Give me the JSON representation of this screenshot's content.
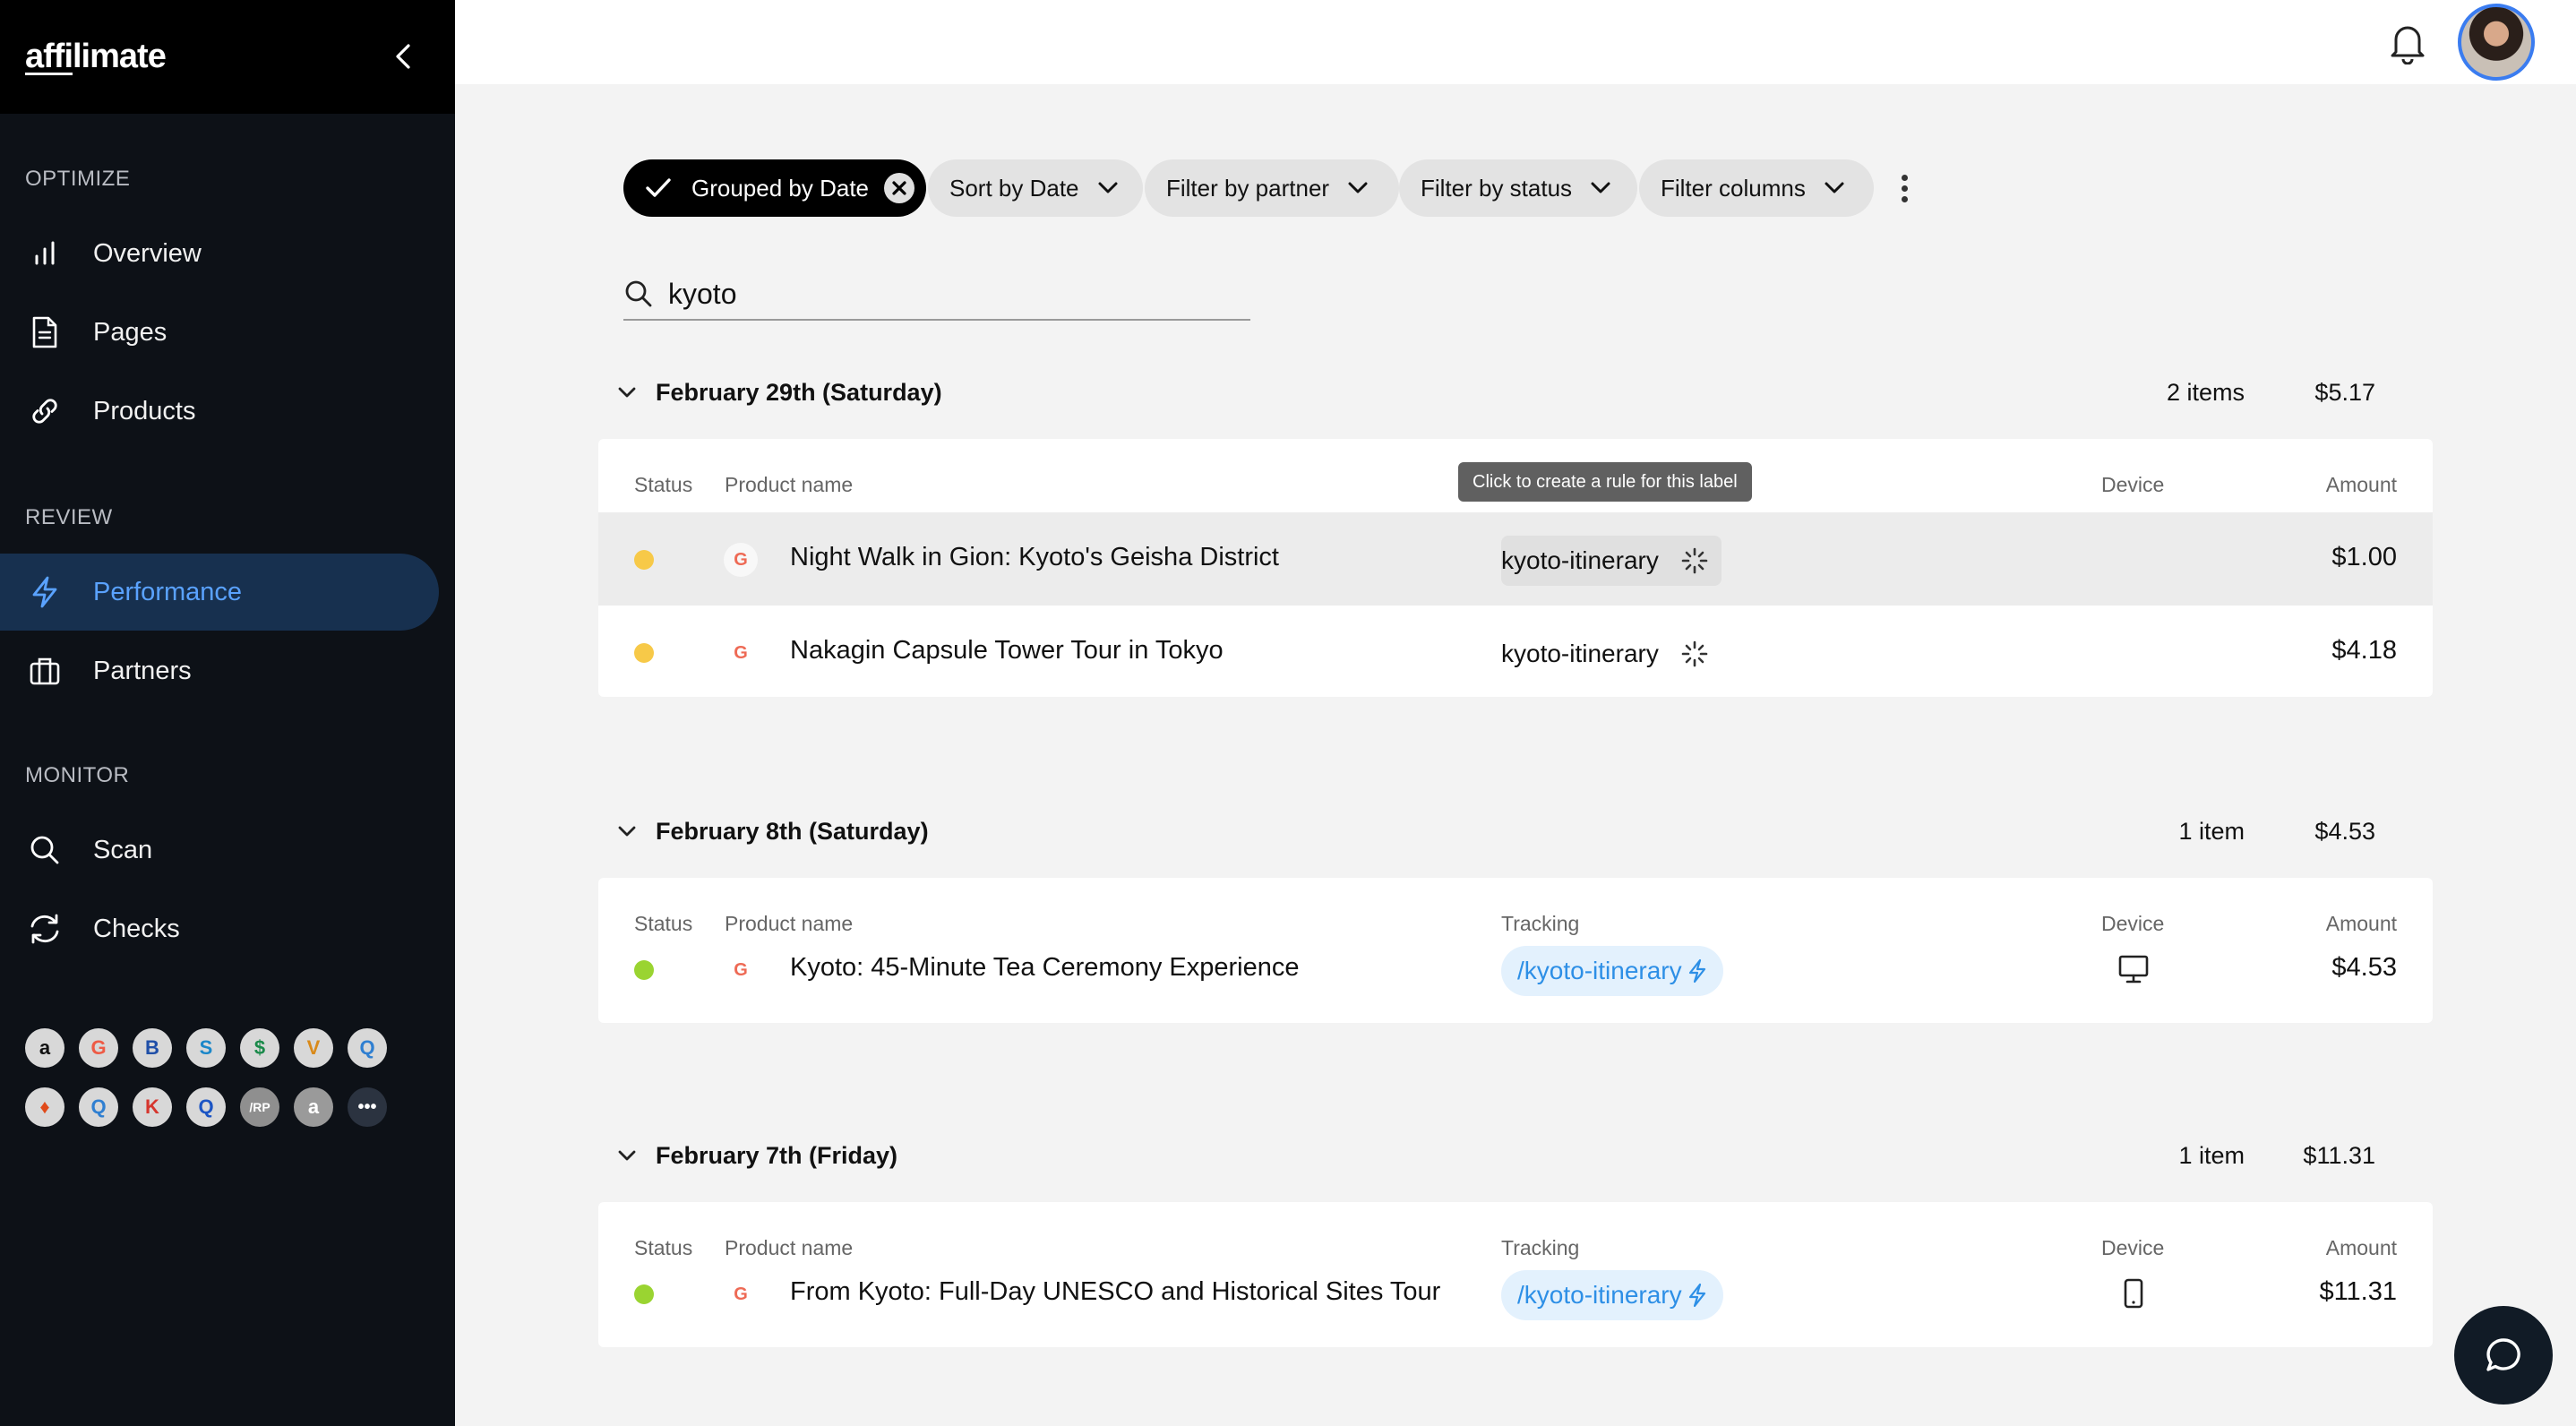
{
  "brand": {
    "logo_prefix": "affi",
    "logo_suffix": "limate"
  },
  "sidebar": {
    "sections": [
      {
        "label": "OPTIMIZE"
      },
      {
        "label": "REVIEW"
      },
      {
        "label": "MONITOR"
      }
    ],
    "items": [
      {
        "label": "Overview",
        "icon": "bar-chart-icon"
      },
      {
        "label": "Pages",
        "icon": "document-icon"
      },
      {
        "label": "Products",
        "icon": "link-icon"
      },
      {
        "label": "Performance",
        "icon": "lightning-icon",
        "active": true
      },
      {
        "label": "Partners",
        "icon": "briefcase-icon"
      },
      {
        "label": "Scan",
        "icon": "search-icon"
      },
      {
        "label": "Checks",
        "icon": "refresh-icon"
      }
    ],
    "partners": [
      {
        "glyph": "a",
        "color": "#d8d8d8",
        "fg": "#111"
      },
      {
        "glyph": "G",
        "color": "#d8d8d8",
        "fg": "#ee5a45"
      },
      {
        "glyph": "B",
        "color": "#d8d8d8",
        "fg": "#1f4fa8"
      },
      {
        "glyph": "S",
        "color": "#d8d8d8",
        "fg": "#1b87c9"
      },
      {
        "glyph": "$",
        "color": "#d8d8d8",
        "fg": "#1a8a4a"
      },
      {
        "glyph": "V",
        "color": "#d8d8d8",
        "fg": "#d98a1a"
      },
      {
        "glyph": "Q",
        "color": "#d8d8d8",
        "fg": "#2f7fd1"
      },
      {
        "glyph": "♦",
        "color": "#d8d8d8",
        "fg": "#e04a1a"
      },
      {
        "glyph": "Q",
        "color": "#d8d8d8",
        "fg": "#2f7fd1"
      },
      {
        "glyph": "K",
        "color": "#d8d8d8",
        "fg": "#d6362e"
      },
      {
        "glyph": "Q",
        "color": "#d8d8d8",
        "fg": "#1c55c4"
      },
      {
        "glyph": "/RP",
        "color": "#8f8f8f",
        "fg": "#fff"
      },
      {
        "glyph": "a",
        "color": "#9a9a9a",
        "fg": "#fff"
      },
      {
        "glyph": "•••",
        "color": "#2b3340",
        "fg": "#fff"
      }
    ]
  },
  "filters": {
    "grouped": "Grouped by Date",
    "sort": "Sort by Date",
    "partner": "Filter by partner",
    "status": "Filter by status",
    "columns": "Filter columns"
  },
  "search": {
    "value": "kyoto"
  },
  "columns": {
    "status": "Status",
    "product": "Product name",
    "tracking": "Tracking",
    "device": "Device",
    "amount": "Amount"
  },
  "tooltip": "Click to create a rule for this label",
  "groups": [
    {
      "title": "February 29th (Saturday)",
      "count": "2 items",
      "total": "$5.17",
      "rows": [
        {
          "status_color": "#f7c948",
          "name": "Night Walk in Gion: Kyoto's Geisha District",
          "tracking": "kyoto-itinerary",
          "amount": "$1.00"
        },
        {
          "status_color": "#f7c948",
          "name": "Nakagin Capsule Tower Tour in Tokyo",
          "tracking": "kyoto-itinerary",
          "amount": "$4.18"
        }
      ]
    },
    {
      "title": "February 8th (Saturday)",
      "count": "1 item",
      "total": "$4.53",
      "rows": [
        {
          "status_color": "#9ad431",
          "name": "Kyoto: 45-Minute Tea Ceremony Experience",
          "tracking": "/kyoto-itinerary",
          "device": "desktop-icon",
          "amount": "$4.53"
        }
      ]
    },
    {
      "title": "February 7th (Friday)",
      "count": "1 item",
      "total": "$11.31",
      "rows": [
        {
          "status_color": "#9ad431",
          "name": "From Kyoto: Full-Day UNESCO and Historical Sites Tour",
          "tracking": "/kyoto-itinerary",
          "device": "mobile-icon",
          "amount": "$11.31"
        }
      ]
    }
  ]
}
